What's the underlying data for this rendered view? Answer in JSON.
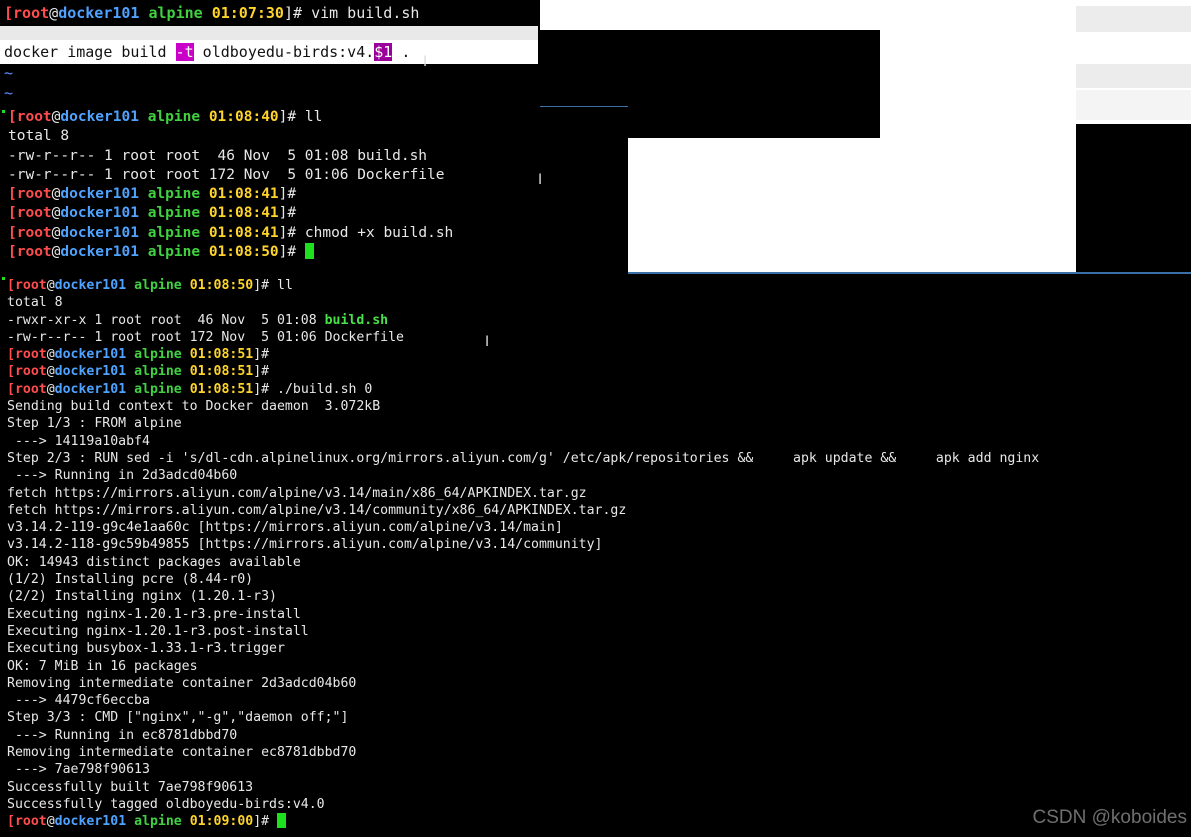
{
  "pane1": {
    "prompt": {
      "user": "root",
      "at": "@",
      "host": "docker101",
      "dir": "alpine",
      "time": "01:07:30",
      "end": "]# ",
      "cmd": "vim build.sh"
    },
    "editor": {
      "pre": "docker image build ",
      "flag": "-t",
      "mid": " oldboyedu-birds:v4.",
      "var": "$1",
      "post": " ."
    },
    "tilde1": "~",
    "tilde2": "~"
  },
  "pane2": {
    "lines": [
      {
        "user": "root",
        "at": "@",
        "host": "docker101",
        "dir": "alpine",
        "time": "01:08:40",
        "end": "]# ",
        "cmd": "ll"
      },
      {
        "text": "total 8"
      },
      {
        "text": "-rw-r--r-- 1 root root  46 Nov  5 01:08 build.sh"
      },
      {
        "text": "-rw-r--r-- 1 root root 172 Nov  5 01:06 Dockerfile"
      },
      {
        "user": "root",
        "at": "@",
        "host": "docker101",
        "dir": "alpine",
        "time": "01:08:41",
        "end": "]#",
        "cmd": ""
      },
      {
        "user": "root",
        "at": "@",
        "host": "docker101",
        "dir": "alpine",
        "time": "01:08:41",
        "end": "]#",
        "cmd": ""
      },
      {
        "user": "root",
        "at": "@",
        "host": "docker101",
        "dir": "alpine",
        "time": "01:08:41",
        "end": "]# ",
        "cmd": "chmod +x build.sh"
      },
      {
        "user": "root",
        "at": "@",
        "host": "docker101",
        "dir": "alpine",
        "time": "01:08:50",
        "end": "]# ",
        "cmd": ""
      }
    ]
  },
  "pane3": {
    "lines": [
      {
        "user": "root",
        "at": "@",
        "host": "docker101",
        "dir": "alpine",
        "time": "01:08:50",
        "end": "]# ",
        "cmd": "ll"
      },
      {
        "text": "total 8"
      },
      {
        "pre": "-rwxr-xr-x 1 root root  46 Nov  5 01:08 ",
        "exe": "build.sh"
      },
      {
        "text": "-rw-r--r-- 1 root root 172 Nov  5 01:06 Dockerfile"
      },
      {
        "user": "root",
        "at": "@",
        "host": "docker101",
        "dir": "alpine",
        "time": "01:08:51",
        "end": "]#",
        "cmd": ""
      },
      {
        "user": "root",
        "at": "@",
        "host": "docker101",
        "dir": "alpine",
        "time": "01:08:51",
        "end": "]#",
        "cmd": ""
      },
      {
        "user": "root",
        "at": "@",
        "host": "docker101",
        "dir": "alpine",
        "time": "01:08:51",
        "end": "]# ",
        "cmd": "./build.sh 0"
      },
      {
        "text": "Sending build context to Docker daemon  3.072kB"
      },
      {
        "text": "Step 1/3 : FROM alpine"
      },
      {
        "text": " ---> 14119a10abf4"
      },
      {
        "text": "Step 2/3 : RUN sed -i 's/dl-cdn.alpinelinux.org/mirrors.aliyun.com/g' /etc/apk/repositories &&     apk update &&     apk add nginx"
      },
      {
        "text": " ---> Running in 2d3adcd04b60"
      },
      {
        "text": "fetch https://mirrors.aliyun.com/alpine/v3.14/main/x86_64/APKINDEX.tar.gz"
      },
      {
        "text": "fetch https://mirrors.aliyun.com/alpine/v3.14/community/x86_64/APKINDEX.tar.gz"
      },
      {
        "text": "v3.14.2-119-g9c4e1aa60c [https://mirrors.aliyun.com/alpine/v3.14/main]"
      },
      {
        "text": "v3.14.2-118-g9c59b49855 [https://mirrors.aliyun.com/alpine/v3.14/community]"
      },
      {
        "text": "OK: 14943 distinct packages available"
      },
      {
        "text": "(1/2) Installing pcre (8.44-r0)"
      },
      {
        "text": "(2/2) Installing nginx (1.20.1-r3)"
      },
      {
        "text": "Executing nginx-1.20.1-r3.pre-install"
      },
      {
        "text": "Executing nginx-1.20.1-r3.post-install"
      },
      {
        "text": "Executing busybox-1.33.1-r3.trigger"
      },
      {
        "text": "OK: 7 MiB in 16 packages"
      },
      {
        "text": "Removing intermediate container 2d3adcd04b60"
      },
      {
        "text": " ---> 4479cf6eccba"
      },
      {
        "text": "Step 3/3 : CMD [\"nginx\",\"-g\",\"daemon off;\"]"
      },
      {
        "text": " ---> Running in ec8781dbbd70"
      },
      {
        "text": "Removing intermediate container ec8781dbbd70"
      },
      {
        "text": " ---> 7ae798f90613"
      },
      {
        "text": "Successfully built 7ae798f90613"
      },
      {
        "text": "Successfully tagged oldboyedu-birds:v4.0"
      },
      {
        "user": "root",
        "at": "@",
        "host": "docker101",
        "dir": "alpine",
        "time": "01:09:00",
        "end": "]# ",
        "cmd": ""
      }
    ]
  },
  "watermark": "CSDN @koboides"
}
